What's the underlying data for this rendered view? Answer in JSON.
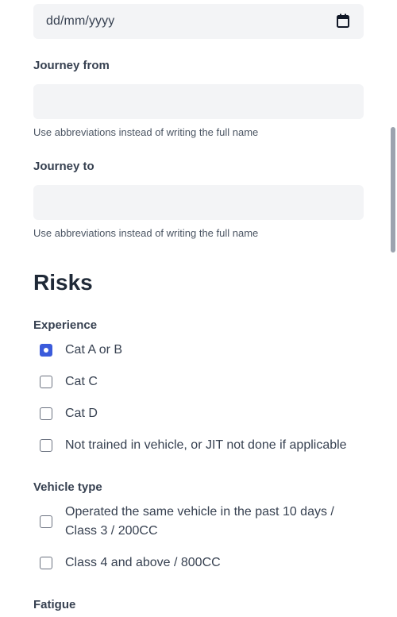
{
  "date_field": {
    "placeholder": "dd/mm/yyyy",
    "icon": "calendar-icon"
  },
  "journey_from": {
    "label": "Journey from",
    "value": "",
    "help": "Use abbreviations instead of writing the full name"
  },
  "journey_to": {
    "label": "Journey to",
    "value": "",
    "help": "Use abbreviations instead of writing the full name"
  },
  "risks": {
    "title": "Risks",
    "experience": {
      "label": "Experience",
      "options": [
        {
          "label": "Cat A or B",
          "checked": true
        },
        {
          "label": "Cat C",
          "checked": false
        },
        {
          "label": "Cat D",
          "checked": false
        },
        {
          "label": "Not trained in vehicle, or JIT not done if applicable",
          "checked": false
        }
      ]
    },
    "vehicle_type": {
      "label": "Vehicle type",
      "options": [
        {
          "label": "Operated the same vehicle in the past 10 days / Class 3 / 200CC",
          "checked": false
        },
        {
          "label": "Class 4 and above / 800CC",
          "checked": false
        }
      ]
    },
    "fatigue": {
      "label": "Fatigue"
    }
  },
  "colors": {
    "accent": "#3b5bdb",
    "input_bg": "#f3f4f6",
    "text": "#374151"
  }
}
